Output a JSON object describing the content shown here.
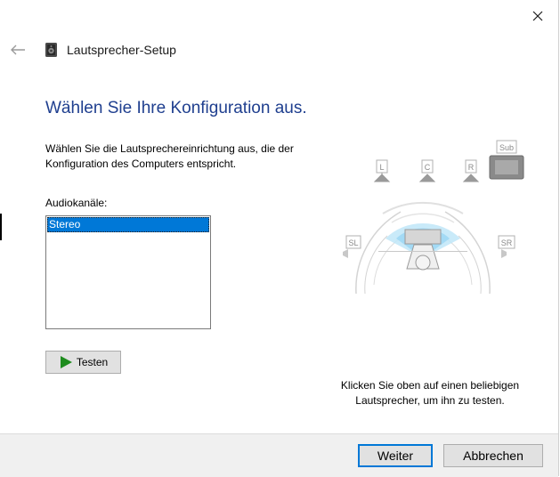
{
  "window": {
    "title": "Lautsprecher-Setup",
    "close_icon": "close-icon",
    "back_icon": "back-arrow-icon"
  },
  "page": {
    "heading": "Wählen Sie Ihre Konfiguration aus.",
    "description": "Wählen Sie die Lautsprechereinrichtung aus, die der Konfiguration des Computers entspricht.",
    "channels_label": "Audiokanäle:",
    "channels": [
      "Stereo"
    ],
    "selected_channel": "Stereo",
    "test_button": "Testen",
    "hint": "Klicken Sie oben auf einen beliebigen Lautsprecher, um ihn zu testen."
  },
  "diagram": {
    "speakers": {
      "left": "L",
      "center": "C",
      "right": "R",
      "sub": "Sub",
      "surround_left": "SL",
      "surround_right": "SR"
    }
  },
  "footer": {
    "next_button": "Weiter",
    "cancel_button": "Abbrechen"
  },
  "colors": {
    "accent": "#0078d7",
    "heading": "#1f3f8f",
    "test_play": "#1e8c1e"
  }
}
